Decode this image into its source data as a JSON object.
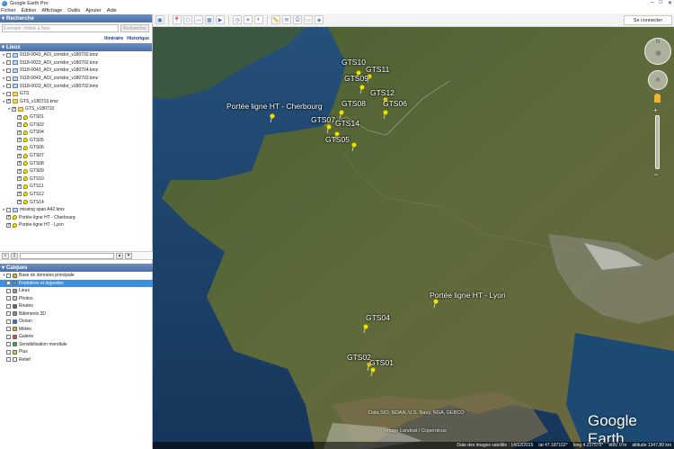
{
  "window": {
    "title": "Google Earth Pro"
  },
  "menu": [
    "Fichier",
    "Édition",
    "Affichage",
    "Outils",
    "Ajouter",
    "Aide"
  ],
  "toolbar": {
    "signin_label": "Se connecter"
  },
  "search": {
    "header": "Recherche",
    "placeholder": "Exemple: Hôtels à Nice",
    "button": "Rechercher",
    "link_itinerary": "Itinéraire",
    "link_history": "Historique"
  },
  "places": {
    "header": "Lieux",
    "items": [
      {
        "label": "9118-0043_AOI_corridor_v180702.kmz",
        "checked": false,
        "icon": "file"
      },
      {
        "label": "9118-0023_AOI_corridor_v180702.kmz",
        "checked": false,
        "icon": "file"
      },
      {
        "label": "9118-0043_AOI_corridor_v180704.kmz",
        "checked": false,
        "icon": "file"
      },
      {
        "label": "9118-0043_AOI_corridor_v180702.kmz",
        "checked": false,
        "icon": "file"
      },
      {
        "label": "9118-0023_AOI_corridor_v180702.kmz",
        "checked": false,
        "icon": "file"
      },
      {
        "label": "GTS",
        "checked": false,
        "icon": "folder"
      },
      {
        "label": "GTS_v180710.kmz",
        "checked": true,
        "icon": "folder"
      },
      {
        "label": "GTS_v180710",
        "checked": true,
        "icon": "folder",
        "indent": 1
      },
      {
        "label": "GTS01",
        "checked": true,
        "icon": "pin",
        "indent": 2
      },
      {
        "label": "GTS02",
        "checked": true,
        "icon": "pin",
        "indent": 2
      },
      {
        "label": "GTS04",
        "checked": true,
        "icon": "pin",
        "indent": 2
      },
      {
        "label": "GTS05",
        "checked": true,
        "icon": "pin",
        "indent": 2
      },
      {
        "label": "GTS06",
        "checked": true,
        "icon": "pin",
        "indent": 2
      },
      {
        "label": "GTS07",
        "checked": true,
        "icon": "pin",
        "indent": 2
      },
      {
        "label": "GTS08",
        "checked": true,
        "icon": "pin",
        "indent": 2
      },
      {
        "label": "GTS09",
        "checked": true,
        "icon": "pin",
        "indent": 2
      },
      {
        "label": "GTS10",
        "checked": true,
        "icon": "pin",
        "indent": 2
      },
      {
        "label": "GTS11",
        "checked": true,
        "icon": "pin",
        "indent": 2
      },
      {
        "label": "GTS12",
        "checked": true,
        "icon": "pin",
        "indent": 2
      },
      {
        "label": "GTS14",
        "checked": true,
        "icon": "pin",
        "indent": 2
      },
      {
        "label": "missing span A42.kmz",
        "checked": false,
        "icon": "file"
      },
      {
        "label": "Portée ligne HT - Cherbourg",
        "checked": true,
        "icon": "pin"
      },
      {
        "label": "Portée ligne HT - Lyon",
        "checked": true,
        "icon": "pin"
      }
    ]
  },
  "layers": {
    "header": "Calques",
    "items": [
      {
        "label": "Base de données principale",
        "icon_color": "#e8a33b",
        "selected": false
      },
      {
        "label": "Frontières et légendes",
        "icon_color": "#6a8fd0",
        "selected": true
      },
      {
        "label": "Lieux",
        "icon_color": "#999999",
        "selected": false
      },
      {
        "label": "Photos",
        "icon_color": "#cfcfcf",
        "selected": false
      },
      {
        "label": "Routes",
        "icon_color": "#666666",
        "selected": false
      },
      {
        "label": "Bâtiments 3D",
        "icon_color": "#8a8a8a",
        "selected": false
      },
      {
        "label": "Océan",
        "icon_color": "#2b78c8",
        "selected": false
      },
      {
        "label": "Météo",
        "icon_color": "#e8a33b",
        "selected": false
      },
      {
        "label": "Galerie",
        "icon_color": "#d44a4a",
        "selected": false
      },
      {
        "label": "Sensibilisation mondiale",
        "icon_color": "#3aa84a",
        "selected": false
      },
      {
        "label": "Plus",
        "icon_color": "#f0c23a",
        "selected": false
      },
      {
        "label": "Relief",
        "icon_color": "#ffffff",
        "selected": false
      }
    ]
  },
  "map": {
    "placemarks": [
      {
        "label": "GTS10"
      },
      {
        "label": "GTS11"
      },
      {
        "label": "GTS09"
      },
      {
        "label": "GTS12"
      },
      {
        "label": "GTS08"
      },
      {
        "label": "GTS06"
      },
      {
        "label": "GTS07"
      },
      {
        "label": "GTS14"
      },
      {
        "label": "GTS05"
      },
      {
        "label": "Portée ligne HT - Cherbourg"
      },
      {
        "label": "Portée ligne HT - Lyon"
      },
      {
        "label": "GTS04"
      },
      {
        "label": "GTS02"
      },
      {
        "label": "GTS01"
      }
    ],
    "logo": "Google Earth",
    "credit_1": "Data SIO, NOAA, U.S. Navy, NGA, GEBCO",
    "credit_2": "Image Landsat / Copernicus",
    "status": {
      "imagery_date": "Date des images satellite : 14/12/2015",
      "lat": "lat  47.187102°",
      "lon": "long  4.217575°",
      "elev": "élév.  0 m",
      "eye_alt": "altitude  1347.89 km"
    }
  }
}
